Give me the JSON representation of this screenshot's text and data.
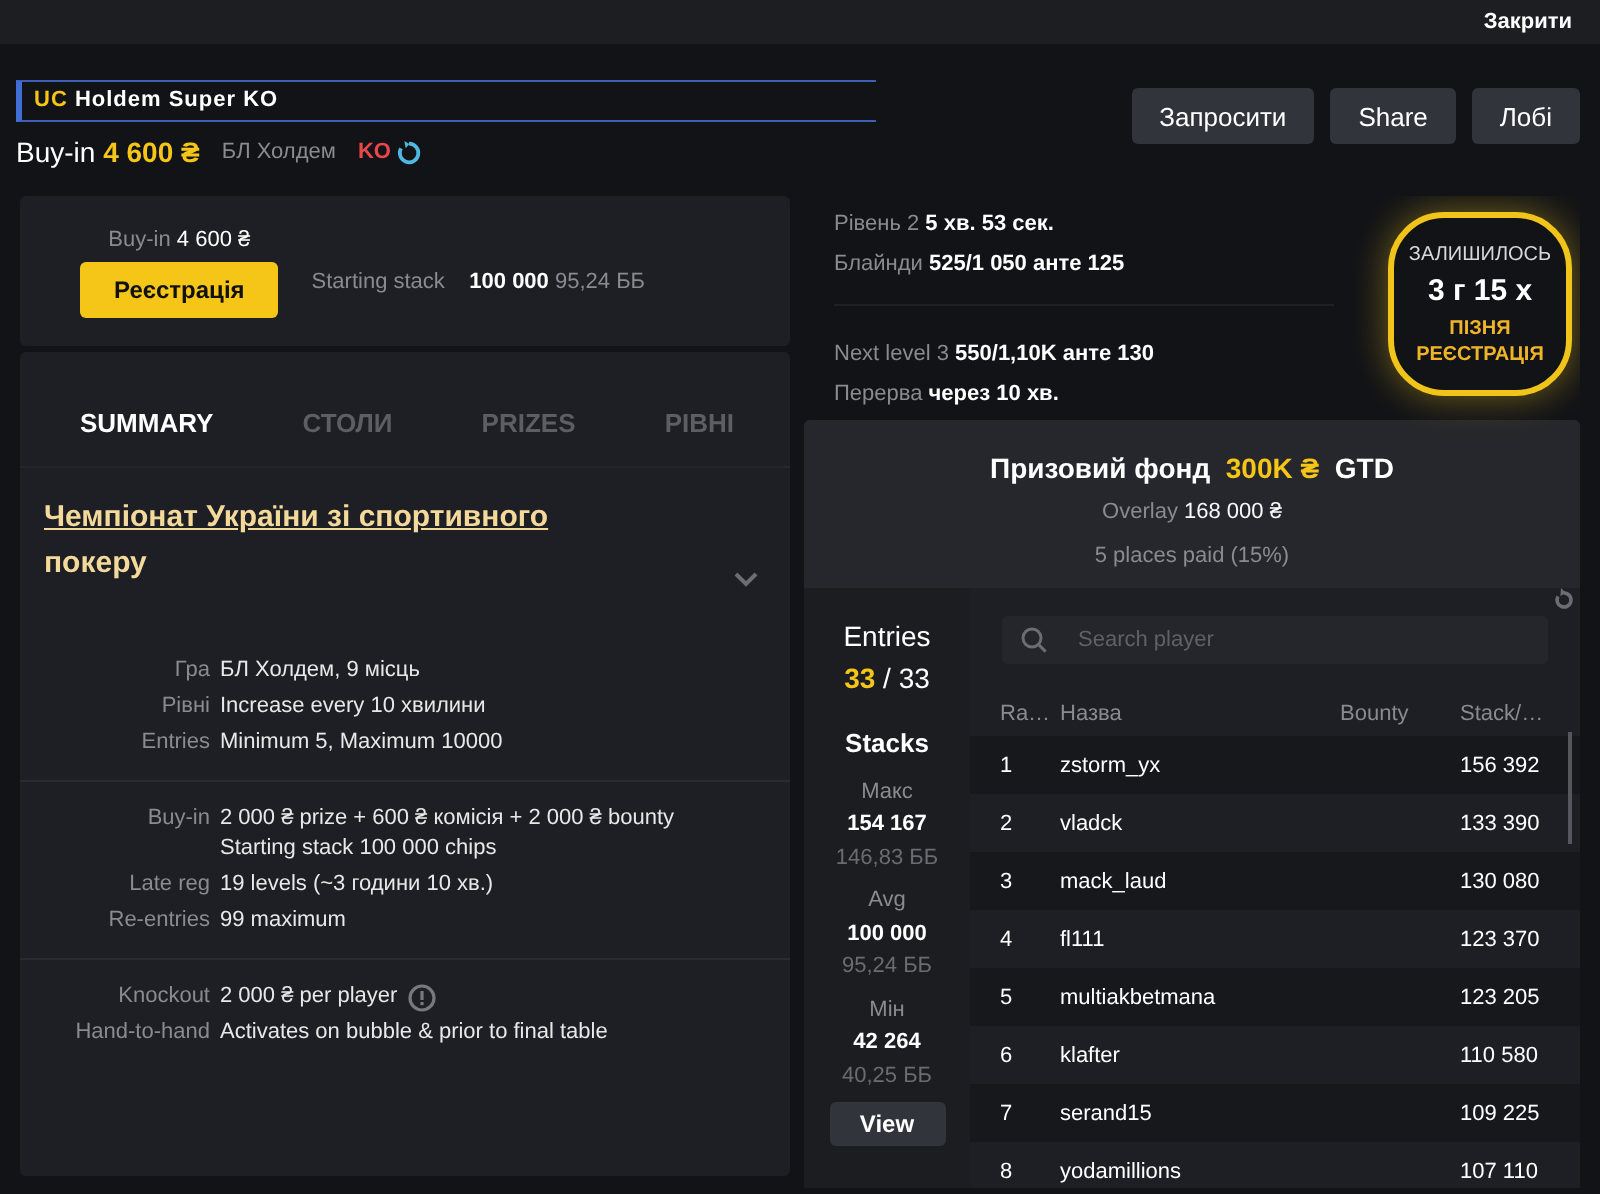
{
  "top_bar": {
    "close": "Закрити"
  },
  "header": {
    "title_prefix": "UC",
    "title": "Holdem Super KO",
    "buyin_label": "Buy-in",
    "buyin_value": "4 600 ₴",
    "game": "БЛ Холдем",
    "ko_tag": "KO",
    "buttons": [
      "Запросити",
      "Share",
      "Лобі"
    ]
  },
  "register_card": {
    "buyin_label": "Buy-in",
    "buyin_value": "4 600 ₴",
    "register_button": "Реєстрація",
    "stack_label": "Starting stack",
    "stack_value": "100 000",
    "stack_bb": "95,24 ББ"
  },
  "tabs": [
    {
      "label": "SUMMARY",
      "selected": true
    },
    {
      "label": "СТОЛИ",
      "selected": false
    },
    {
      "label": "PRIZES",
      "selected": false
    },
    {
      "label": "РІВНІ",
      "selected": false
    }
  ],
  "summary": {
    "title_link": "Чемпіонат України зі спортивного",
    "title_rest": "покеру",
    "groups": [
      [
        {
          "label": "Гра",
          "lines": [
            "БЛ Холдем, 9 місць"
          ]
        },
        {
          "label": "Рівні",
          "lines": [
            "Increase every 10 хвилини"
          ]
        },
        {
          "label": "Entries",
          "lines": [
            "Minimum 5, Maximum 10000"
          ]
        }
      ],
      [
        {
          "label": "Buy-in",
          "lines": [
            "2 000 ₴ prize + 600 ₴ комісія + 2 000 ₴ bounty",
            "Starting stack 100 000 chips"
          ]
        },
        {
          "label": "Late reg",
          "lines": [
            "19 levels (~3 години 10 хв.)"
          ]
        },
        {
          "label": "Re-entries",
          "lines": [
            "99 maximum"
          ]
        }
      ],
      [
        {
          "label": "Knockout",
          "lines": [
            "2 000 ₴ per player"
          ],
          "info": true
        },
        {
          "label": "Hand-to-hand",
          "lines": [
            "Activates on bubble & prior to final table"
          ]
        }
      ]
    ]
  },
  "level_info": [
    [
      {
        "label": "Рівень 2",
        "value": "5 хв. 53 сек."
      },
      {
        "label": "Блайнди",
        "value": "525/1 050 анте 125"
      }
    ],
    [
      {
        "label": "Next level 3",
        "value": "550/1,10K анте 130"
      },
      {
        "label": "Перерва",
        "value": "через 10 хв."
      }
    ]
  ],
  "late_reg_badge": {
    "caption": "ЗАЛИШИЛОСЬ",
    "time": "3 г 15 х",
    "label": "ПІЗНЯ РЕЄСТРАЦІЯ"
  },
  "prize_pool": {
    "label": "Призовий фонд",
    "amount": "300K ₴",
    "suffix": "GTD",
    "overlay_label": "Overlay",
    "overlay_value": "168 000 ₴",
    "places": "5 places paid (15%)"
  },
  "stats": {
    "entries_label": "Entries",
    "entries_current": "33",
    "entries_total": "/ 33",
    "stacks_label": "Stacks",
    "items": [
      {
        "label": "Макс",
        "value": "154 167",
        "bb": "146,83 ББ"
      },
      {
        "label": "Avg",
        "value": "100 000",
        "bb": "95,24 ББ"
      },
      {
        "label": "Мін",
        "value": "42 264",
        "bb": "40,25 ББ"
      }
    ],
    "view_button": "View"
  },
  "players": {
    "search": {
      "placeholder": "Search player"
    },
    "columns": [
      "Ra…",
      "Назва",
      "Bounty",
      "Stack/…"
    ],
    "rows": [
      [
        "1",
        "zstorm_yx",
        "156 392"
      ],
      [
        "2",
        "vladck",
        "133 390"
      ],
      [
        "3",
        "mack_laud",
        "130 080"
      ],
      [
        "4",
        "fl111",
        "123 370"
      ],
      [
        "5",
        "multiakbetmana",
        "123 205"
      ],
      [
        "6",
        "klafter",
        "110 580"
      ],
      [
        "7",
        "serand15",
        "109 225"
      ],
      [
        "8",
        "yodamillions",
        "107 110"
      ]
    ]
  }
}
